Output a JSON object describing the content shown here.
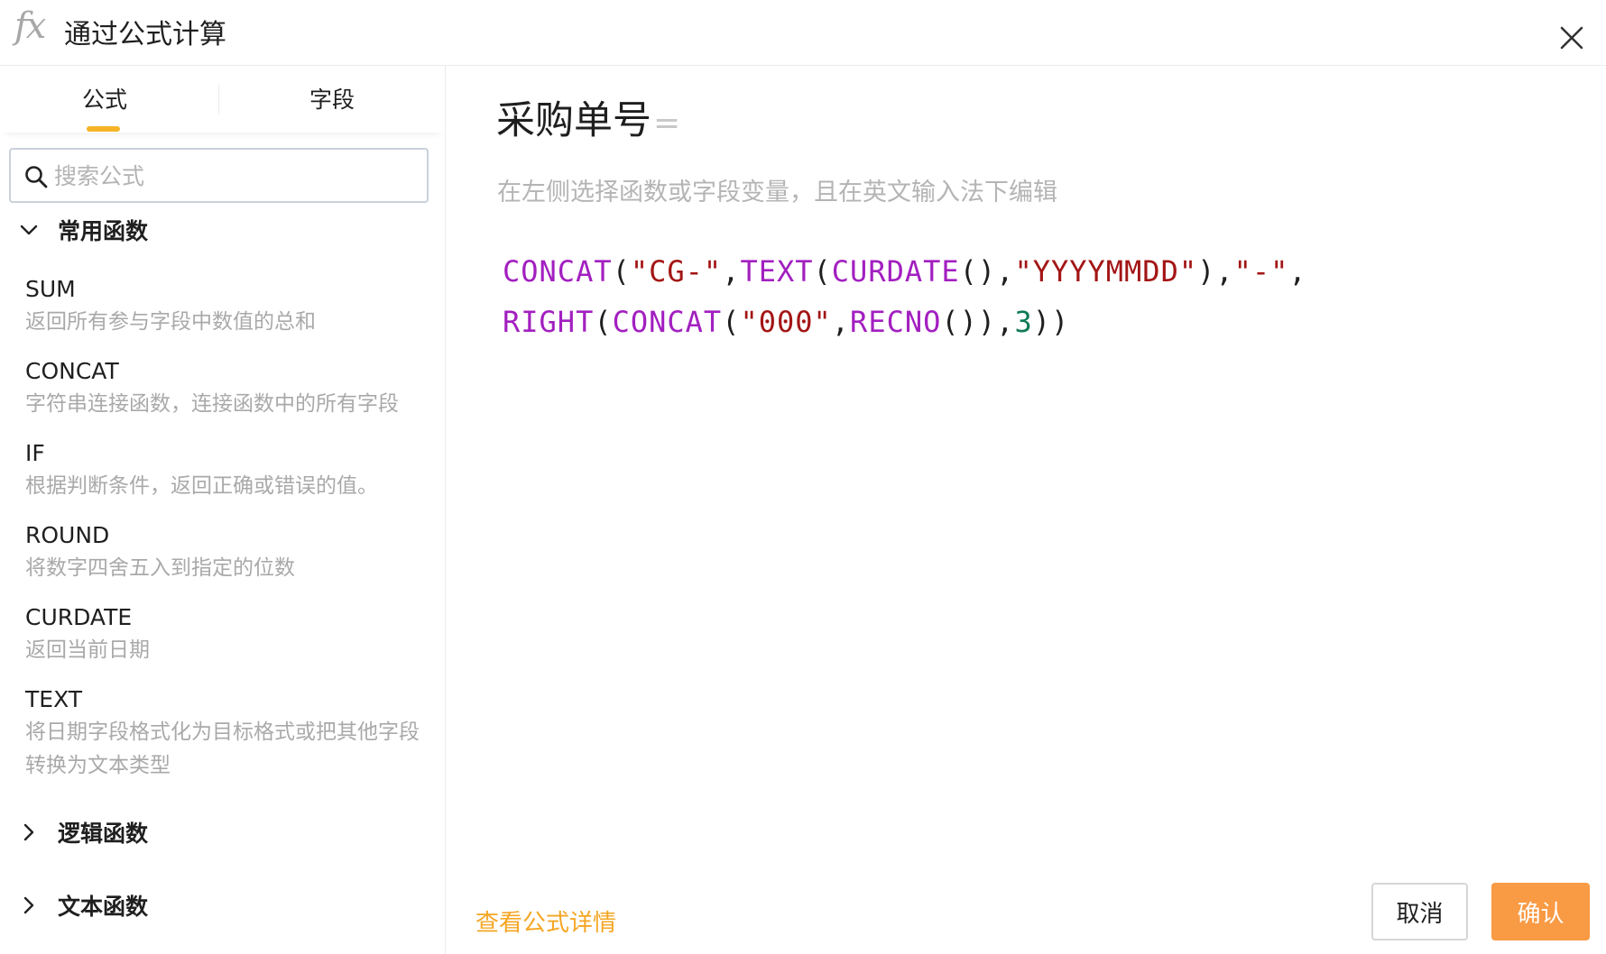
{
  "header": {
    "icon_text": "fx",
    "title": "通过公式计算"
  },
  "sidebar": {
    "tabs": [
      {
        "label": "公式",
        "active": true
      },
      {
        "label": "字段",
        "active": false
      }
    ],
    "search": {
      "placeholder": "搜索公式",
      "value": ""
    },
    "groups": [
      {
        "label": "常用函数",
        "expanded": true,
        "items": [
          {
            "name": "SUM",
            "desc": "返回所有参与字段中数值的总和"
          },
          {
            "name": "CONCAT",
            "desc": "字符串连接函数，连接函数中的所有字段"
          },
          {
            "name": "IF",
            "desc": "根据判断条件，返回正确或错误的值。"
          },
          {
            "name": "ROUND",
            "desc": "将数字四舍五入到指定的位数"
          },
          {
            "name": "CURDATE",
            "desc": "返回当前日期"
          },
          {
            "name": "TEXT",
            "desc": "将日期字段格式化为目标格式或把其他字段转换为文本类型"
          }
        ]
      },
      {
        "label": "逻辑函数",
        "expanded": false
      },
      {
        "label": "文本函数",
        "expanded": false
      }
    ]
  },
  "main": {
    "field_name": "采购单号",
    "equals": "=",
    "hint": "在左侧选择函数或字段变量，且在英文输入法下编辑",
    "formula_lines": [
      [
        {
          "t": "fn",
          "v": "CONCAT"
        },
        {
          "t": "punc",
          "v": "("
        },
        {
          "t": "str",
          "v": "\"CG-\""
        },
        {
          "t": "punc",
          "v": ","
        },
        {
          "t": "fn",
          "v": "TEXT"
        },
        {
          "t": "punc",
          "v": "("
        },
        {
          "t": "fn",
          "v": "CURDATE"
        },
        {
          "t": "punc",
          "v": "(),"
        },
        {
          "t": "str",
          "v": "\"YYYYMMDD\""
        },
        {
          "t": "punc",
          "v": "),"
        },
        {
          "t": "str",
          "v": "\"-\""
        },
        {
          "t": "punc",
          "v": ","
        }
      ],
      [
        {
          "t": "fn",
          "v": "RIGHT"
        },
        {
          "t": "punc",
          "v": "("
        },
        {
          "t": "fn",
          "v": "CONCAT"
        },
        {
          "t": "punc",
          "v": "("
        },
        {
          "t": "str",
          "v": "\"000\""
        },
        {
          "t": "punc",
          "v": ","
        },
        {
          "t": "fn",
          "v": "RECNO"
        },
        {
          "t": "punc",
          "v": "()),"
        },
        {
          "t": "num",
          "v": "3"
        },
        {
          "t": "punc",
          "v": "))"
        }
      ]
    ],
    "detail_link": "查看公式详情",
    "buttons": {
      "cancel": "取消",
      "confirm": "确认"
    }
  },
  "colors": {
    "accent": "#f5b325",
    "confirm_button": "#f99a44",
    "link": "#f5a623",
    "function_token": "#a21fc0",
    "string_token": "#a31515",
    "number_token": "#0f7a55"
  }
}
